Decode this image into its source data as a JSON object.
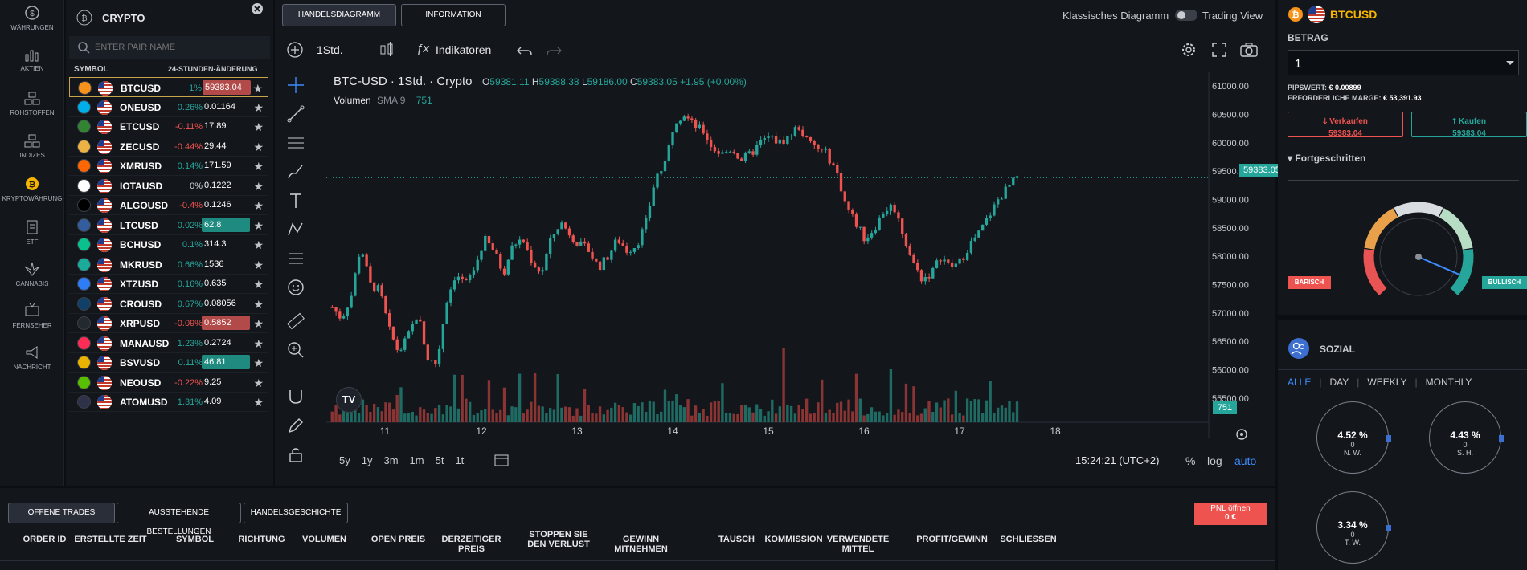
{
  "nav": [
    {
      "label": "WÄHRUNGEN",
      "icon": "currency-icon"
    },
    {
      "label": "AKTIEN",
      "icon": "stocks-icon"
    },
    {
      "label": "ROHSTOFFEN",
      "icon": "commodities-icon"
    },
    {
      "label": "INDIZES",
      "icon": "indices-icon"
    },
    {
      "label": "KRYPTOWÄHRUNG",
      "icon": "bitcoin-icon"
    },
    {
      "label": "ETF",
      "icon": "etf-icon"
    },
    {
      "label": "CANNABIS",
      "icon": "cannabis-icon"
    },
    {
      "label": "FERNSEHER",
      "icon": "tv-icon"
    },
    {
      "label": "NACHRICHT",
      "icon": "megaphone-icon"
    }
  ],
  "crypto": {
    "title": "CRYPTO",
    "search_placeholder": "ENTER PAIR NAME",
    "col_symbol": "SYMBOL",
    "col_change": "24-STUNDEN-ÄNDERUNG",
    "rows": [
      {
        "sym": "BTCUSD",
        "chg": "1%",
        "price": "59383.04",
        "dir": "pos",
        "hl": "red",
        "coin": "#f7931a"
      },
      {
        "sym": "ONEUSD",
        "chg": "0.26%",
        "price": "0.01164",
        "dir": "pos",
        "hl": "",
        "coin": "#00aee9"
      },
      {
        "sym": "ETCUSD",
        "chg": "-0.11%",
        "price": "17.89",
        "dir": "neg",
        "hl": "",
        "coin": "#328332"
      },
      {
        "sym": "ZECUSD",
        "chg": "-0.44%",
        "price": "29.44",
        "dir": "neg",
        "hl": "",
        "coin": "#ecb244"
      },
      {
        "sym": "XMRUSD",
        "chg": "0.14%",
        "price": "171.59",
        "dir": "pos",
        "hl": "",
        "coin": "#ff6600"
      },
      {
        "sym": "IOTAUSD",
        "chg": "0%",
        "price": "0.1222",
        "dir": "neu",
        "hl": "",
        "coin": "#ffffff"
      },
      {
        "sym": "ALGOUSD",
        "chg": "-0.4%",
        "price": "0.1246",
        "dir": "neg",
        "hl": "",
        "coin": "#000000"
      },
      {
        "sym": "LTCUSD",
        "chg": "0.02%",
        "price": "62.8",
        "dir": "pos",
        "hl": "green",
        "coin": "#345d9d"
      },
      {
        "sym": "BCHUSD",
        "chg": "0.1%",
        "price": "314.3",
        "dir": "pos",
        "hl": "",
        "coin": "#0ac18e"
      },
      {
        "sym": "MKRUSD",
        "chg": "0.66%",
        "price": "1536",
        "dir": "pos",
        "hl": "",
        "coin": "#1aab9b"
      },
      {
        "sym": "XTZUSD",
        "chg": "0.16%",
        "price": "0.635",
        "dir": "pos",
        "hl": "",
        "coin": "#2c7df7"
      },
      {
        "sym": "CROUSD",
        "chg": "0.67%",
        "price": "0.08056",
        "dir": "pos",
        "hl": "",
        "coin": "#103f68"
      },
      {
        "sym": "XRPUSD",
        "chg": "-0.09%",
        "price": "0.5852",
        "dir": "neg",
        "hl": "red",
        "coin": "#23292f"
      },
      {
        "sym": "MANAUSD",
        "chg": "1.23%",
        "price": "0.2724",
        "dir": "pos",
        "hl": "",
        "coin": "#ff2d55"
      },
      {
        "sym": "BSVUSD",
        "chg": "0.11%",
        "price": "46.81",
        "dir": "pos",
        "hl": "green",
        "coin": "#eab300"
      },
      {
        "sym": "NEOUSD",
        "chg": "-0.22%",
        "price": "9.25",
        "dir": "neg",
        "hl": "",
        "coin": "#58bf00"
      },
      {
        "sym": "ATOMUSD",
        "chg": "1.31%",
        "price": "4.09",
        "dir": "pos",
        "hl": "",
        "coin": "#2e3148"
      }
    ]
  },
  "tabs": {
    "chart": "HANDELSDIAGRAMM",
    "info": "INFORMATION"
  },
  "view": {
    "classic": "Klassisches Diagramm",
    "tv": "Trading View"
  },
  "toolbar": {
    "interval": "1Std.",
    "indicators": "Indikatoren"
  },
  "chart_data": {
    "type": "candlestick",
    "title": "BTC-USD · 1Std. · Crypto",
    "ohlc": {
      "o": "59381.11",
      "h": "59388.38",
      "l": "59186.00",
      "c": "59383.05",
      "chg": "+1.95 (+0.00%)"
    },
    "volume_label": "Volumen",
    "sma_label": "SMA 9",
    "sma_value": "751",
    "yticks": [
      "61000.00",
      "60500.00",
      "60000.00",
      "59500.00",
      "59000.00",
      "58500.00",
      "58000.00",
      "57500.00",
      "57000.00",
      "56500.00",
      "56000.00",
      "55500.00"
    ],
    "xticks": [
      "11",
      "12",
      "13",
      "14",
      "15",
      "16",
      "17",
      "18"
    ],
    "ylim": [
      55300,
      61100
    ],
    "last_price": "59383.05",
    "vol_badge": "751",
    "close_path": [
      57100,
      56900,
      57300,
      58200,
      57500,
      57400,
      56700,
      56300,
      56600,
      57000,
      56200,
      56100,
      57200,
      57700,
      57500,
      57800,
      58300,
      58100,
      57700,
      58200,
      58300,
      57900,
      57700,
      58300,
      58600,
      58400,
      58200,
      58100,
      57800,
      58000,
      58300,
      58100,
      58200,
      58600,
      59400,
      59600,
      60400,
      60500,
      60300,
      60200,
      59900,
      59800,
      59900,
      59700,
      59800,
      60000,
      60100,
      60000,
      60100,
      60300,
      60000,
      59900,
      59800,
      59500,
      58900,
      58600,
      58300,
      58500,
      58800,
      58900,
      58400,
      57900,
      57600,
      57700,
      58000,
      57800,
      57900,
      58200,
      58400,
      58700,
      59000,
      59200,
      59383
    ]
  },
  "chart_footer": {
    "ranges": [
      "5y",
      "1y",
      "3m",
      "1m",
      "5t",
      "1t"
    ],
    "time": "15:24:21 (UTC+2)",
    "pct": "%",
    "log": "log",
    "auto": "auto"
  },
  "bottom": {
    "tabs": [
      "OFFENE TRADES",
      "AUSSTEHENDE BESTELLUNGEN",
      "HANDELSGESCHICHTE"
    ],
    "pnl_line1": "PNL öffnen",
    "pnl_line2": "0 €",
    "cols": [
      "ORDER ID",
      "ERSTELLTE ZEIT",
      "SYMBOL",
      "RICHTUNG",
      "VOLUMEN",
      "OPEN PREIS",
      "DERZEITIGER PREIS",
      "STOPPEN SIE DEN VERLUST",
      "GEWINN MITNEHMEN",
      "TAUSCH",
      "KOMMISSION",
      "VERWENDETE MITTEL",
      "PROFIT/GEWINN",
      "SCHLIESSEN"
    ]
  },
  "right": {
    "symbol": "BTCUSD",
    "amount_label": "BETRAG",
    "amount_value": "1",
    "pip_label": "PIPSWERT:",
    "pip_value": "€ 0.00899",
    "margin_label": "ERFORDERLICHE MARGE:",
    "margin_value": "€ 53,391.93",
    "sell_label": "Verkaufen",
    "sell_price": "59383.04",
    "buy_label": "Kaufen",
    "buy_price": "59383.04",
    "advanced": "Fortgeschritten",
    "bearish": "BÄRISCH",
    "bullish": "BULLISCH",
    "gauge_level": 0.92,
    "social": "SOZIAL",
    "filters": [
      "ALLE",
      "DAY",
      "WEEKLY",
      "MONTHLY"
    ],
    "circles": [
      {
        "pct": "4.52 %",
        "num": "0",
        "lbl": "N. W."
      },
      {
        "pct": "4.43 %",
        "num": "0",
        "lbl": "S. H."
      },
      {
        "pct": "3.34 %",
        "num": "0",
        "lbl": "T. W."
      }
    ]
  },
  "colors": {
    "up": "#26a69a",
    "down": "#ef5350",
    "accent": "#3d8bfd",
    "gold": "#f7b500"
  }
}
